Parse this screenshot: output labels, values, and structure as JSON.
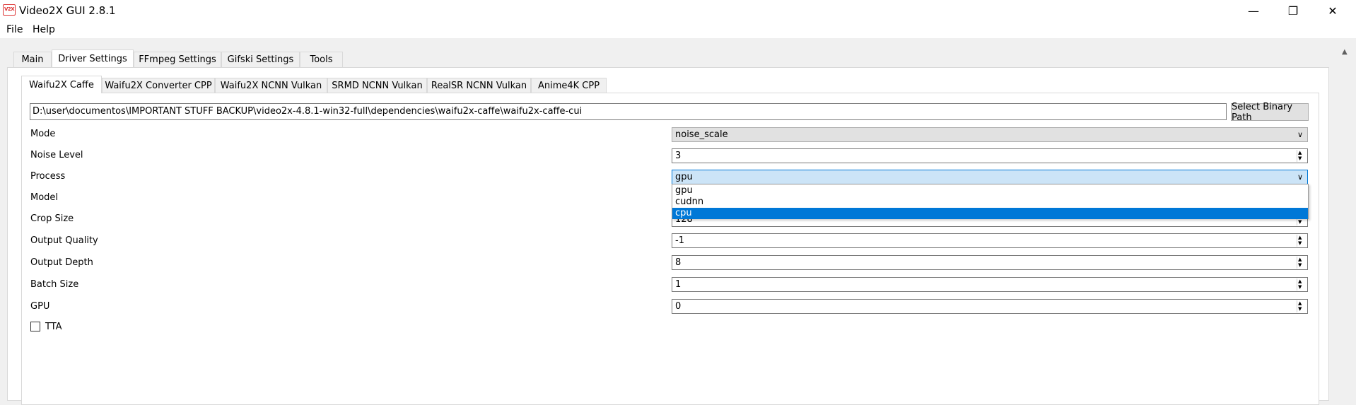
{
  "window": {
    "title": "Video2X GUI 2.8.1",
    "icon_text": "V2X",
    "controls": {
      "minimize": "—",
      "maximize": "❐",
      "close": "✕"
    }
  },
  "menu": {
    "items": [
      "File",
      "Help"
    ]
  },
  "tabs": [
    "Main",
    "Driver Settings",
    "FFmpeg Settings",
    "Gifski Settings",
    "Tools"
  ],
  "active_tab": "Driver Settings",
  "driver_tabs": [
    "Waifu2X Caffe",
    "Waifu2X Converter CPP",
    "Waifu2X NCNN Vulkan",
    "SRMD NCNN Vulkan",
    "RealSR NCNN Vulkan",
    "Anime4K CPP"
  ],
  "active_driver_tab": "Waifu2X Caffe",
  "binary_path": {
    "value": "D:\\user\\documentos\\IMPORTANT STUFF BACKUP\\video2x-4.8.1-win32-full\\dependencies\\waifu2x-caffe\\waifu2x-caffe-cui",
    "button": "Select Binary Path"
  },
  "settings": {
    "mode": {
      "label": "Mode",
      "value": "noise_scale"
    },
    "noise_level": {
      "label": "Noise Level",
      "value": "3"
    },
    "process": {
      "label": "Process",
      "value": "gpu",
      "options": [
        "gpu",
        "cudnn",
        "cpu"
      ],
      "highlighted": "cpu"
    },
    "model": {
      "label": "Model"
    },
    "crop_size": {
      "label": "Crop Size",
      "value": "128"
    },
    "output_quality": {
      "label": "Output Quality",
      "value": "-1"
    },
    "output_depth": {
      "label": "Output Depth",
      "value": "8"
    },
    "batch_size": {
      "label": "Batch Size",
      "value": "1"
    },
    "gpu": {
      "label": "GPU",
      "value": "0"
    },
    "tta": {
      "label": "TTA",
      "checked": false
    }
  }
}
